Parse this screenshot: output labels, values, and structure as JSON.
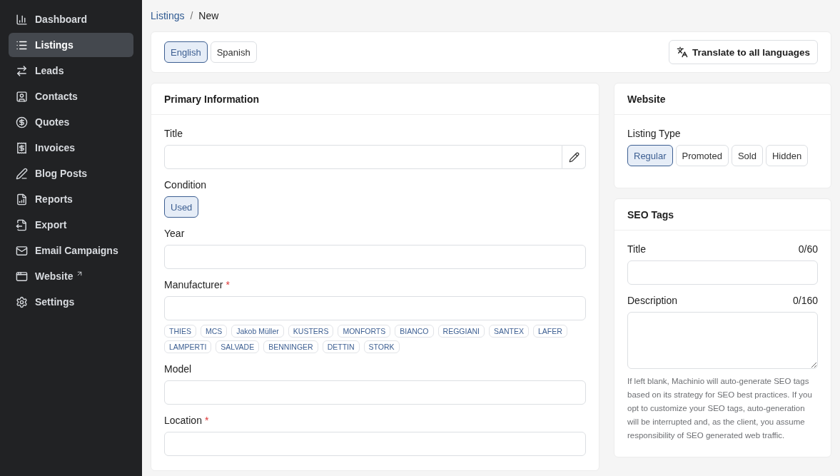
{
  "sidebar": {
    "items": [
      {
        "label": "Dashboard",
        "selected": false,
        "external": false
      },
      {
        "label": "Listings",
        "selected": true,
        "external": false
      },
      {
        "label": "Leads",
        "selected": false,
        "external": false
      },
      {
        "label": "Contacts",
        "selected": false,
        "external": false
      },
      {
        "label": "Quotes",
        "selected": false,
        "external": false
      },
      {
        "label": "Invoices",
        "selected": false,
        "external": false
      },
      {
        "label": "Blog Posts",
        "selected": false,
        "external": false
      },
      {
        "label": "Reports",
        "selected": false,
        "external": false
      },
      {
        "label": "Export",
        "selected": false,
        "external": false
      },
      {
        "label": "Email Campaigns",
        "selected": false,
        "external": false
      },
      {
        "label": "Website",
        "selected": false,
        "external": true
      },
      {
        "label": "Settings",
        "selected": false,
        "external": false
      }
    ]
  },
  "breadcrumb": {
    "parent": "Listings",
    "separator": "/",
    "current": "New"
  },
  "languages": [
    {
      "label": "English",
      "selected": true
    },
    {
      "label": "Spanish",
      "selected": false
    }
  ],
  "translate_button": "Translate to all languages",
  "primary": {
    "title": "Primary Information",
    "fields": [
      {
        "kind": "edit",
        "label": "Title"
      },
      {
        "kind": "choice",
        "label": "Condition",
        "options": [
          {
            "label": "Used",
            "selected": true
          }
        ]
      },
      {
        "kind": "text",
        "label": "Year"
      },
      {
        "kind": "tags",
        "label": "Manufacturer",
        "required_mark": "*",
        "tags": [
          "THIES",
          "MCS",
          "Jakob Müller",
          "KUSTERS",
          "MONFORTS",
          "BIANCO",
          "REGGIANI",
          "SANTEX",
          "LAFER",
          "LAMPERTI",
          "SALVADE",
          "BENNINGER",
          "DETTIN",
          "STORK"
        ]
      },
      {
        "kind": "text",
        "label": "Model"
      },
      {
        "kind": "text",
        "label": "Location",
        "required_mark": "*"
      }
    ]
  },
  "website": {
    "title": "Website",
    "label": "Listing Type",
    "options": [
      {
        "label": "Regular",
        "selected": true
      },
      {
        "label": "Promoted",
        "selected": false
      },
      {
        "label": "Sold",
        "selected": false
      },
      {
        "label": "Hidden",
        "selected": false
      }
    ]
  },
  "seo": {
    "title": "SEO Tags",
    "fields": [
      {
        "kind": "input",
        "label": "Title",
        "counter": "0/60"
      },
      {
        "kind": "textarea",
        "label": "Description",
        "counter": "0/160"
      }
    ],
    "help": "If left blank, Machinio will auto-generate SEO tags based on its strategy for SEO best practices. If you opt to customize your SEO tags, auto-generation will be interrupted and, as the client, you assume responsibility of SEO generated web traffic."
  }
}
